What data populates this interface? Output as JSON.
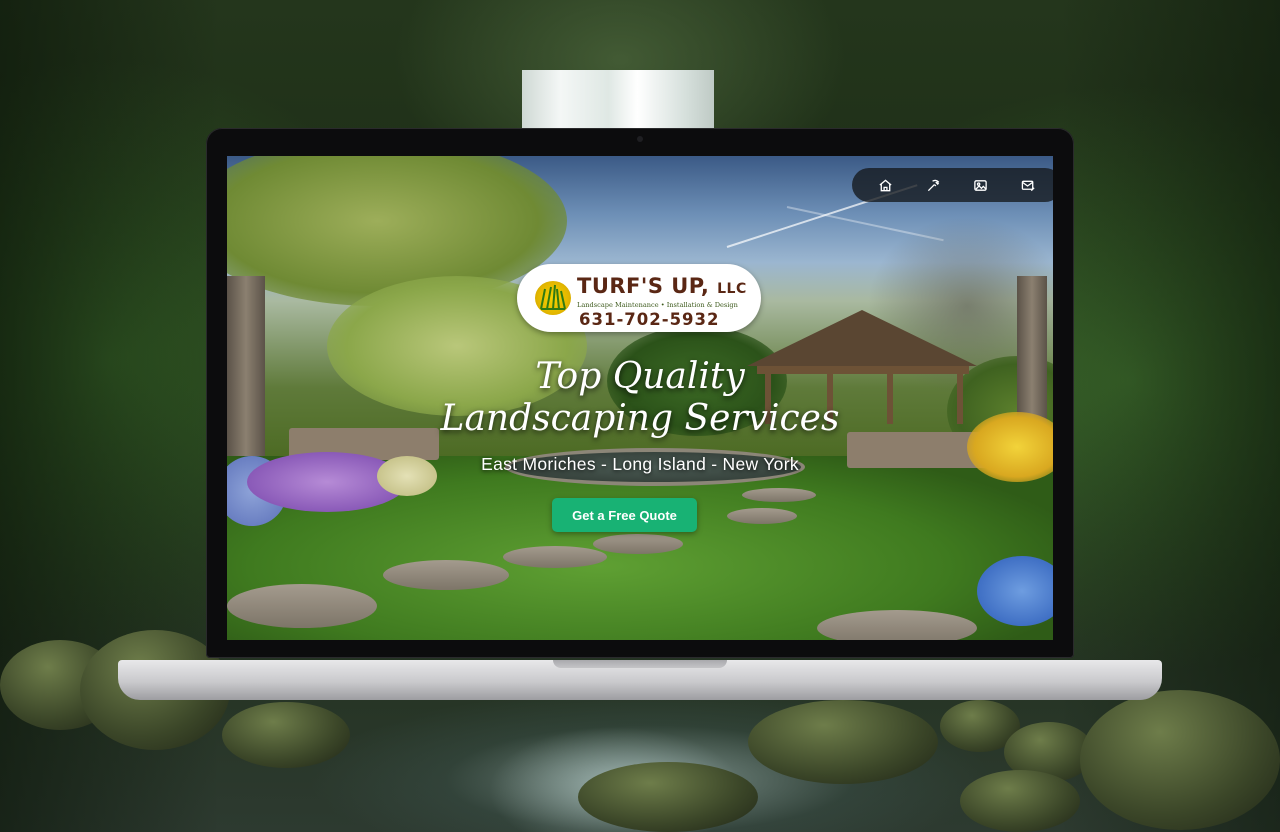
{
  "brand": {
    "name": "TURF'S UP,",
    "suffix": "LLC",
    "tagline": "Landscape Maintenance • Installation & Design",
    "phone": "631-702-5932"
  },
  "nav": {
    "icons": [
      "home-icon",
      "tools-icon",
      "gallery-icon",
      "contact-mail-icon"
    ]
  },
  "hero": {
    "headline_line1": "Top Quality",
    "headline_line2": "Landscaping Services",
    "subline": "East Moriches - Long Island - New York",
    "cta_label": "Get a Free Quote"
  },
  "colors": {
    "cta": "#18b274",
    "brand_brown": "#5a2714",
    "nav_bg": "#14181c"
  }
}
